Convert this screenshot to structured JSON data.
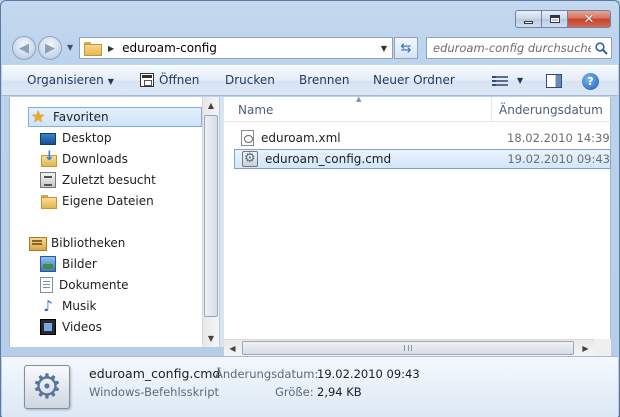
{
  "address": {
    "path": "eduroam-config"
  },
  "search": {
    "placeholder": "eduroam-config durchsuchen"
  },
  "toolbar": {
    "organize_label": "Organisieren",
    "open_label": "Öffnen",
    "print_label": "Drucken",
    "burn_label": "Brennen",
    "new_folder_label": "Neuer Ordner"
  },
  "navigation": {
    "favorites": "Favoriten",
    "favorites_items": [
      "Desktop",
      "Downloads",
      "Zuletzt besucht",
      "Eigene Dateien"
    ],
    "libraries": "Bibliotheken",
    "library_items": [
      "Bilder",
      "Dokumente",
      "Musik",
      "Videos"
    ]
  },
  "columns": {
    "name": "Name",
    "date": "Änderungsdatum"
  },
  "files": [
    {
      "name": "eduroam.xml",
      "date": "18.02.2010 14:39",
      "icon": "xml-file-icon"
    },
    {
      "name": "eduroam_config.cmd",
      "date": "19.02.2010 09:43",
      "icon": "cmd-file-icon",
      "selected": true
    }
  ],
  "details": {
    "name": "eduroam_config.cmd",
    "type": "Windows-Befehlsskript",
    "modified_label": "Änderungsdatum:",
    "modified_value": "19.02.2010 09:43",
    "size_label": "Größe:",
    "size_value": "2,94 KB"
  },
  "colors": {
    "selection": "#d3e5fa",
    "selection_border": "#7da2ce",
    "close_button": "#c7432c"
  }
}
